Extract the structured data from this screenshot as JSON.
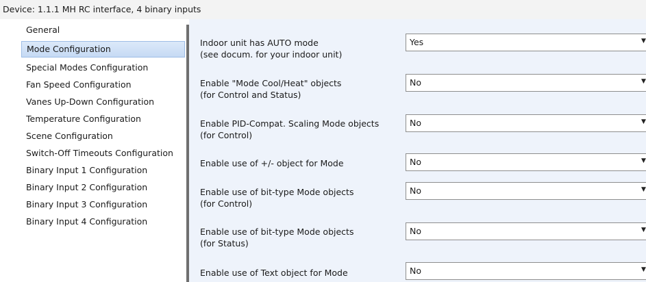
{
  "header": {
    "title": "Device: 1.1.1  MH RC interface, 4 binary inputs"
  },
  "sidebar": {
    "items": [
      {
        "label": "General",
        "selected": false
      },
      {
        "label": "Mode Configuration",
        "selected": true
      },
      {
        "label": "Special Modes Configuration",
        "selected": false
      },
      {
        "label": "Fan Speed Configuration",
        "selected": false
      },
      {
        "label": "Vanes Up-Down Configuration",
        "selected": false
      },
      {
        "label": "Temperature Configuration",
        "selected": false
      },
      {
        "label": "Scene Configuration",
        "selected": false
      },
      {
        "label": "Switch-Off Timeouts Configuration",
        "selected": false
      },
      {
        "label": "Binary Input 1 Configuration",
        "selected": false
      },
      {
        "label": "Binary Input 2 Configuration",
        "selected": false
      },
      {
        "label": "Binary Input 3 Configuration",
        "selected": false
      },
      {
        "label": "Binary Input 4 Configuration",
        "selected": false
      }
    ]
  },
  "params": [
    {
      "line1": "Indoor unit has AUTO mode",
      "line2": "(see docum. for your indoor unit)",
      "value": "Yes"
    },
    {
      "line1": "Enable \"Mode Cool/Heat\" objects",
      "line2": "(for Control and Status)",
      "value": "No"
    },
    {
      "line1": "Enable PID-Compat. Scaling Mode objects",
      "line2": "(for Control)",
      "value": "No"
    },
    {
      "line1": "Enable use of +/- object for Mode",
      "line2": "",
      "value": "No"
    },
    {
      "line1": "Enable use of bit-type Mode objects",
      "line2": "(for Control)",
      "value": "No"
    },
    {
      "line1": "Enable use of bit-type Mode objects",
      "line2": "(for Status)",
      "value": "No"
    },
    {
      "line1": "Enable use of Text object for Mode",
      "line2": "",
      "value": "No"
    }
  ],
  "icons": {
    "dropdown": "chevron-down-icon"
  },
  "colors": {
    "selection": "#c6daf4",
    "content_bg": "#eef3fb",
    "splitter": "#6f6f6f"
  }
}
